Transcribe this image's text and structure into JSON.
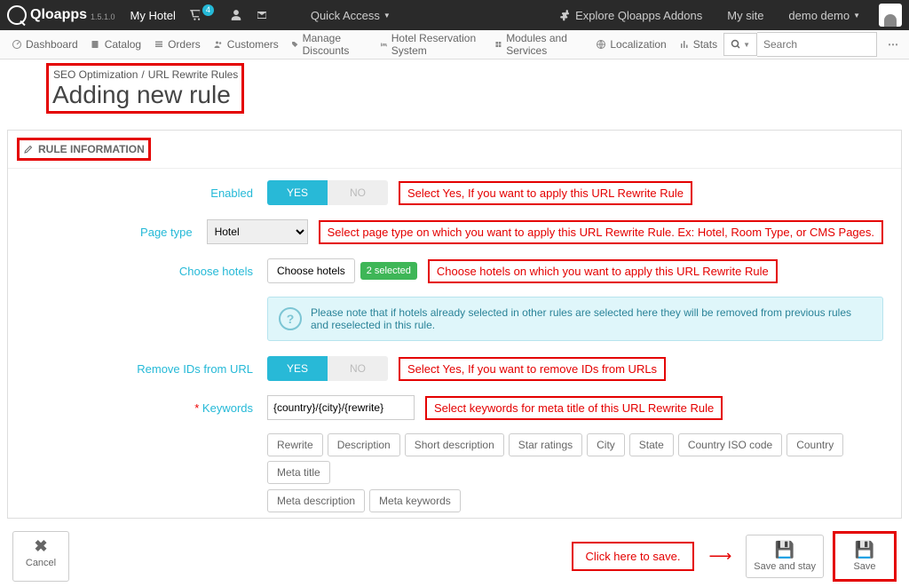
{
  "brand": {
    "name": "Qloapps",
    "version": "1.5.1.0",
    "context": "My Hotel",
    "cart_badge": "4",
    "quick_access": "Quick Access",
    "addons": "Explore Qloapps Addons",
    "mysite": "My site",
    "user": "demo demo"
  },
  "menu": {
    "dashboard": "Dashboard",
    "catalog": "Catalog",
    "orders": "Orders",
    "customers": "Customers",
    "discounts": "Manage Discounts",
    "hotelres": "Hotel Reservation System",
    "modules": "Modules and Services",
    "localization": "Localization",
    "stats": "Stats",
    "search_placeholder": "Search"
  },
  "breadcrumb": {
    "a": "SEO Optimization",
    "b": "URL Rewrite Rules"
  },
  "title": "Adding new rule",
  "panel_title": "RULE INFORMATION",
  "labels": {
    "enabled": "Enabled",
    "page_type": "Page type",
    "choose": "Choose hotels",
    "remove": "Remove IDs from URL",
    "keywords": "Keywords"
  },
  "yn": {
    "yes": "YES",
    "no": "NO"
  },
  "page_type_value": "Hotel",
  "choose": {
    "btn": "Choose hotels",
    "badge": "2 selected"
  },
  "note": "Please note that if hotels already selected in other rules are selected here they will be removed from previous rules and reselected in this rule.",
  "kw_value": "{country}/{city}/{rewrite}",
  "tags": [
    "Rewrite",
    "Description",
    "Short description",
    "Star ratings",
    "City",
    "State",
    "Country ISO code",
    "Country",
    "Meta title",
    "Meta description",
    "Meta keywords"
  ],
  "callouts": {
    "enabled": "Select Yes, If you want to apply this URL Rewrite Rule",
    "page": "Select page type on which you want to apply this URL Rewrite Rule. Ex: Hotel, Room Type, or CMS Pages.",
    "choose": "Choose hotels on which you want to apply this URL Rewrite Rule",
    "remove": "Select Yes, If you want to remove IDs from URLs",
    "kw": "Select keywords for meta title of this URL Rewrite Rule",
    "save": "Click here to save."
  },
  "footer": {
    "cancel": "Cancel",
    "save_stay": "Save and stay",
    "save": "Save"
  }
}
